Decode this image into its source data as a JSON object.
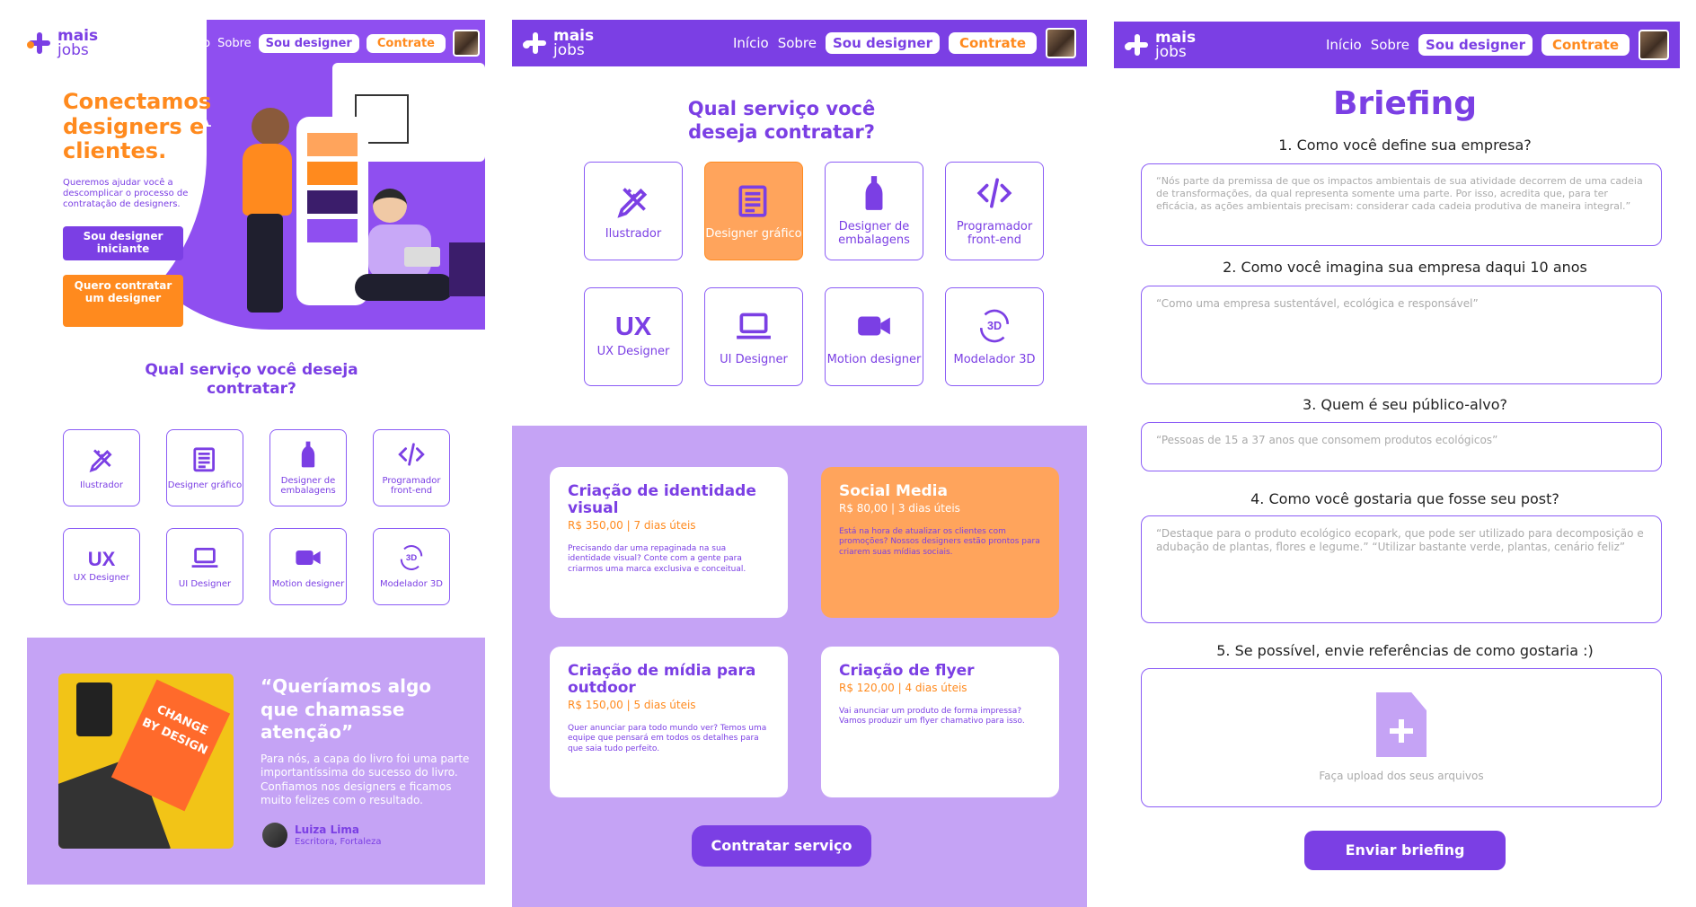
{
  "brand": {
    "name_top": "mais",
    "name_bottom": "jobs"
  },
  "nav": {
    "inicio": "Início",
    "sobre": "Sobre",
    "sou_designer": "Sou designer",
    "contrate": "Contrate"
  },
  "landing": {
    "hero_title": "Conectamos designers e clientes.",
    "hero_text": "Queremos ajudar você a descomplicar o processo de contratação de designers.",
    "btn_designer": "Sou designer iniciante",
    "btn_contratar": "Quero contratar um designer",
    "services_title": "Qual serviço você deseja contratar?",
    "testimonial": {
      "quote": "“Queríamos algo que chamasse atenção”",
      "text": "Para nós, a capa do livro foi uma parte importantíssima do sucesso do livro. Confiamos nos designers e ficamos muito felizes com o resultado.",
      "name": "Luiza Lima",
      "role": "Escritora, Fortaleza",
      "book_word1": "CHANGE",
      "book_word2": "BY DESIGN"
    }
  },
  "services": [
    {
      "label": "Ilustrador",
      "icon": "pencil-ruler-icon"
    },
    {
      "label": "Designer gráfico",
      "icon": "document-icon"
    },
    {
      "label": "Designer de embalagens",
      "icon": "bottle-icon"
    },
    {
      "label": "Programador front-end",
      "icon": "code-icon"
    },
    {
      "label": "UX Designer",
      "icon": "ux-text-icon",
      "glyph": "UX"
    },
    {
      "label": "UI Designer",
      "icon": "laptop-icon"
    },
    {
      "label": "Motion designer",
      "icon": "video-camera-icon"
    },
    {
      "label": "Modelador 3D",
      "icon": "rotate-3d-icon",
      "glyph": "3D"
    }
  ],
  "service_page": {
    "title": "Qual serviço você deseja contratar?",
    "offers": [
      {
        "title": "Criação de identidade visual",
        "price": "R$ 350,00 | 7 dias úteis",
        "desc": "Precisando dar uma repaginada na sua identidade visual? Conte com a gente para criarmos uma marca exclusiva e conceitual."
      },
      {
        "title": "Social Media",
        "price": "R$ 80,00 | 3 dias úteis",
        "desc": "Está na hora de atualizar os clientes com promoções? Nossos designers estão prontos para criarem suas mídias sociais."
      },
      {
        "title": "Criação de mídia para outdoor",
        "price": "R$ 150,00 | 5 dias úteis",
        "desc": "Quer anunciar para todo mundo ver? Temos uma equipe que pensará em todos os detalhes para que saia tudo perfeito."
      },
      {
        "title": "Criação de flyer",
        "price": "R$ 120,00 | 4 dias úteis",
        "desc": "Vai anunciar um produto de forma impressa? Vamos produzir um flyer chamativo para isso."
      }
    ],
    "cta": "Contratar serviço"
  },
  "briefing": {
    "title": "Briefing",
    "q1": "1. Como você define sua empresa?",
    "a1": "“Nós parte da premissa de que os impactos ambientais de sua atividade decorrem de uma cadeia de transformações, da qual representa somente uma parte. Por isso, acredita que, para ter eficácia, as ações ambientais precisam: considerar cada cadeia produtiva de maneira integral.”",
    "q2": "2. Como você imagina sua empresa daqui 10 anos",
    "a2": "“Como uma empresa sustentável, ecológica e responsável”",
    "q3": "3. Quem é seu público-alvo?",
    "a3": "“Pessoas de 15 a 37 anos que consomem produtos ecológicos”",
    "q4": "4. Como você gostaria que fosse seu post?",
    "a4": "“Destaque para o produto ecológico ecopark, que pode ser utilizado para decomposição e adubação de plantas, flores e legume.” “Utilizar bastante verde, plantas, cenário feliz”",
    "q5": "5. Se possível, envie referências de como gostaria :)",
    "upload": "Faça upload dos seus arquivos",
    "submit": "Enviar briefing"
  }
}
